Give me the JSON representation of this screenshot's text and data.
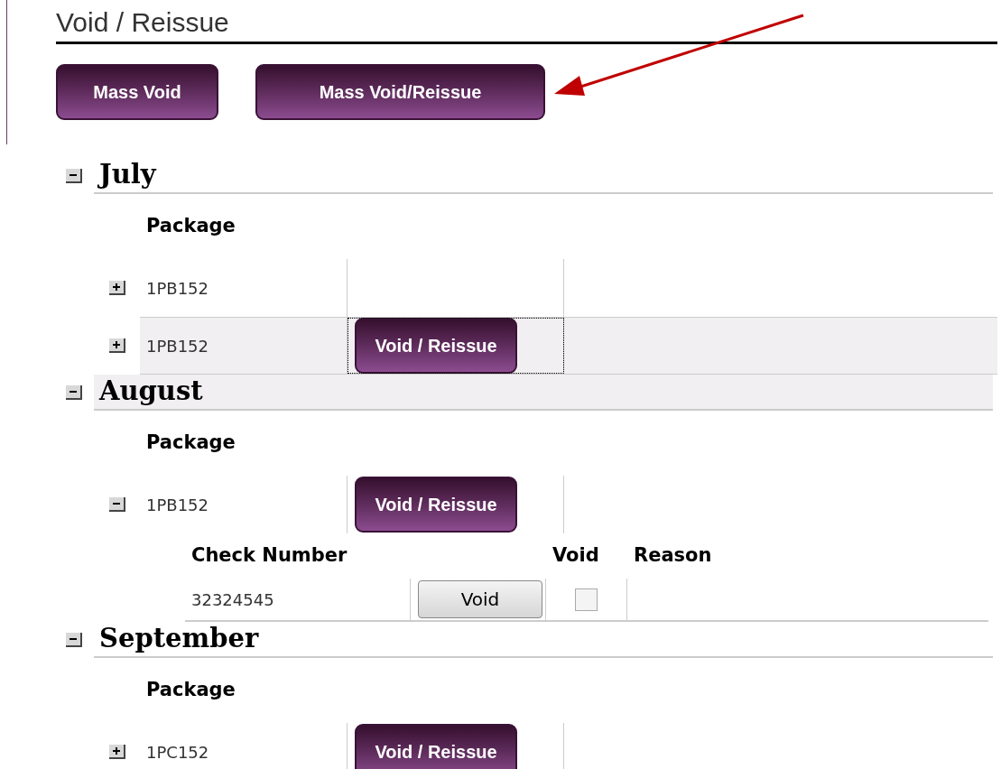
{
  "title": "Void / Reissue",
  "actions": [
    "Mass Void",
    "Mass Void/Reissue"
  ],
  "months": [
    {
      "name": "July",
      "expanded": true,
      "selected": false,
      "package_header": "Package",
      "packages": [
        {
          "code": "1PB152",
          "expanded": false,
          "selected": false
        },
        {
          "code": "1PB152",
          "expanded": false,
          "selected": true,
          "button": "Void / Reissue"
        }
      ]
    },
    {
      "name": "August",
      "expanded": true,
      "selected": true,
      "package_header": "Package",
      "packages": [
        {
          "code": "1PB152",
          "expanded": true,
          "selected": false,
          "button": "Void / Reissue",
          "checks": {
            "columns": [
              "Check Number",
              "Void",
              "Reason"
            ],
            "rows": [
              {
                "number": "32324545",
                "button": "Void",
                "void": false
              }
            ]
          }
        }
      ]
    },
    {
      "name": "September",
      "expanded": true,
      "selected": false,
      "package_header": "Package",
      "packages": [
        {
          "code": "1PC152",
          "expanded": false,
          "selected": false,
          "button": "Void / Reissue"
        }
      ]
    }
  ]
}
